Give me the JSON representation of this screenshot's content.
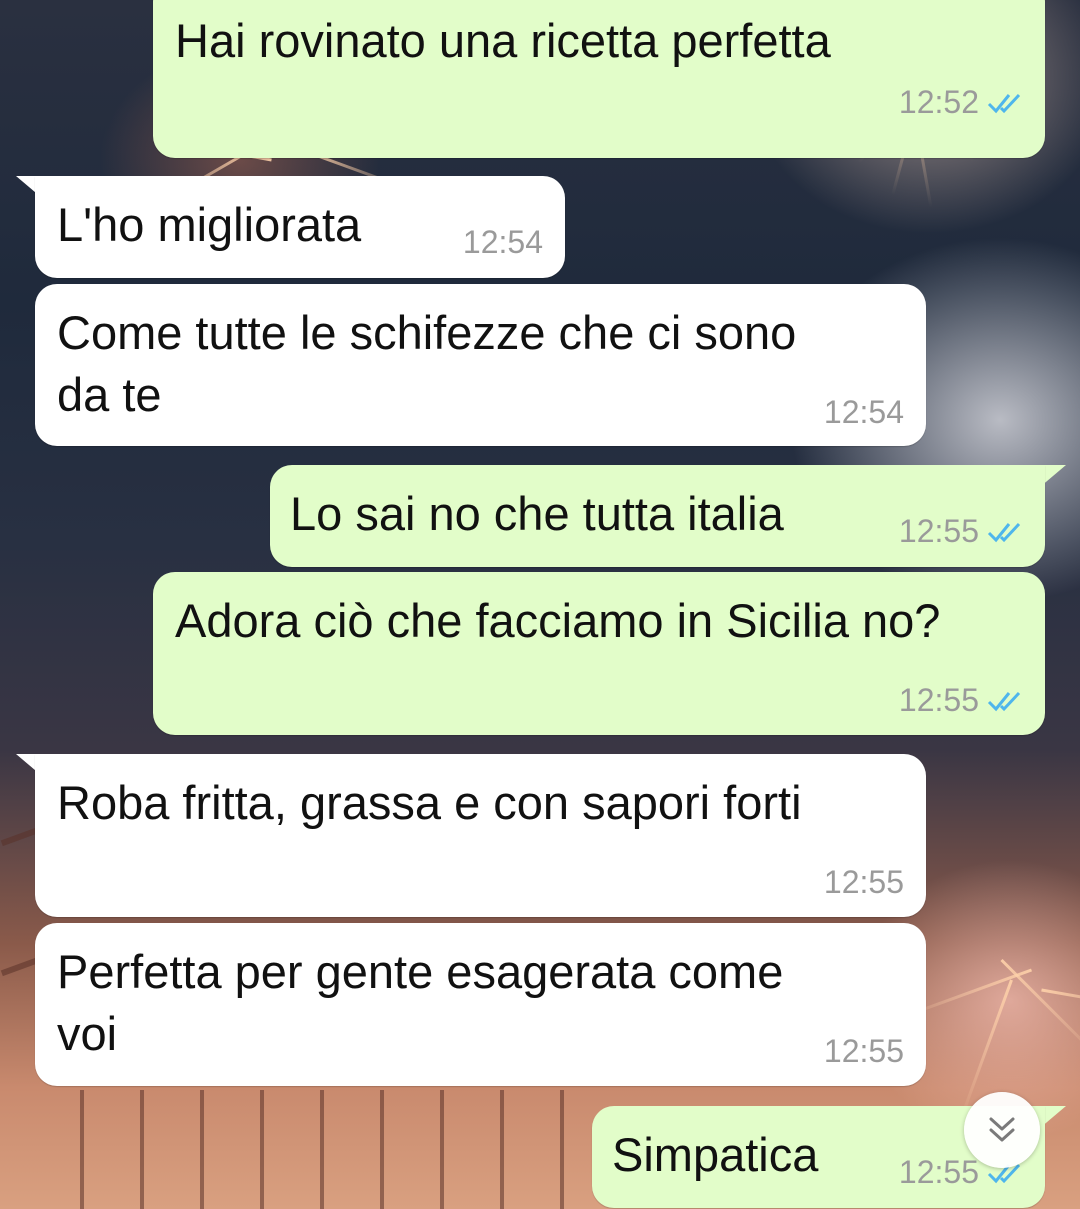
{
  "colors": {
    "outgoing_bubble": "#e2fdc9",
    "incoming_bubble": "#ffffff",
    "timestamp": "#9a9a9a",
    "read_ticks": "#4fb6ec"
  },
  "messages": [
    {
      "direction": "outgoing",
      "text": "Hai rovinato una ricetta perfetta",
      "time": "12:52",
      "status_icon": "double-check-read-icon"
    },
    {
      "direction": "incoming",
      "text": "L'ho migliorata",
      "time": "12:54"
    },
    {
      "direction": "incoming",
      "text": "Come tutte le schifezze che ci sono\nda te",
      "time": "12:54"
    },
    {
      "direction": "outgoing",
      "text": "Lo sai no che tutta italia",
      "time": "12:55",
      "status_icon": "double-check-read-icon"
    },
    {
      "direction": "outgoing",
      "text": "Adora ciò che facciamo in Sicilia no?",
      "time": "12:55",
      "status_icon": "double-check-read-icon"
    },
    {
      "direction": "incoming",
      "text": "Roba fritta, grassa e con sapori forti",
      "time": "12:55"
    },
    {
      "direction": "incoming",
      "text": "Perfetta per gente esagerata come\nvoi",
      "time": "12:55"
    },
    {
      "direction": "outgoing",
      "text": "Simpatica",
      "time": "12:55",
      "status_icon": "double-check-read-icon"
    }
  ],
  "scroll_button": {
    "icon": "double-chevron-down-icon"
  }
}
